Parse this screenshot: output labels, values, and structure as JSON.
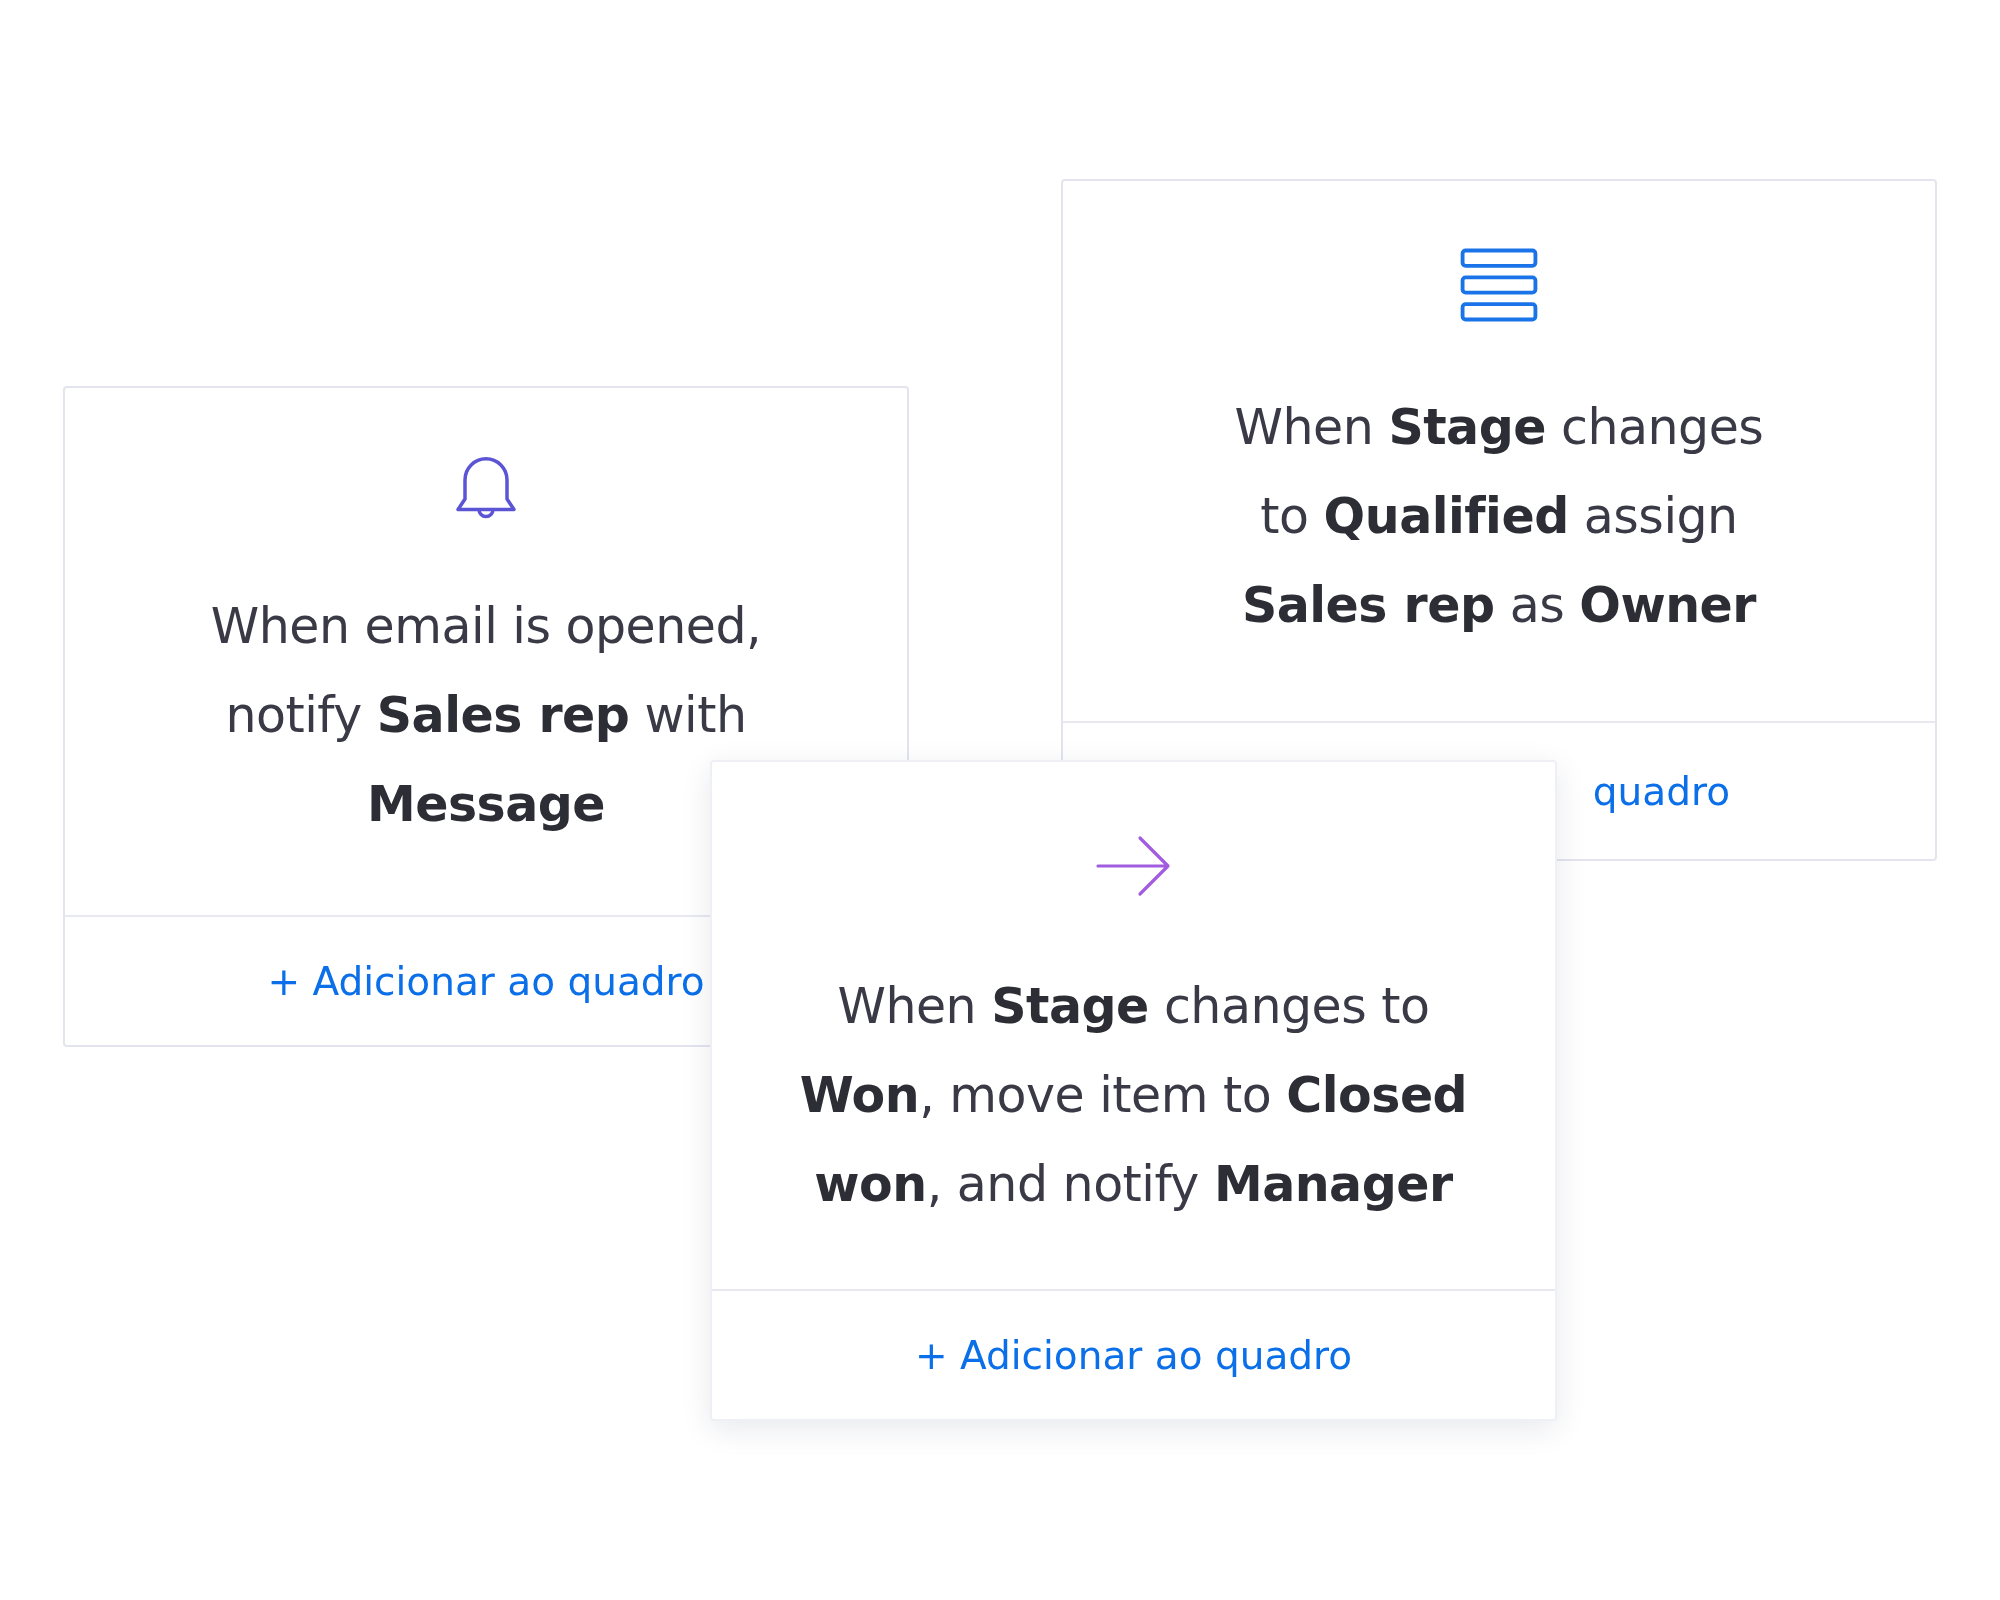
{
  "cards": [
    {
      "kind": "bell",
      "text": "When email is opened,\nnotify **Sales rep** with\n**Message**",
      "link": "+ Adicionar ao quadro"
    },
    {
      "kind": "stack",
      "text": "When **Stage** changes\nto **Qualified** assign\n**Sales rep** as **Owner**",
      "link": "quadro"
    },
    {
      "kind": "arrow",
      "text": "When **Stage** changes to\n**Won**, move item to **Closed**\n**won**, and notify **Manager**",
      "link": "+ Adicionar ao quadro"
    }
  ]
}
